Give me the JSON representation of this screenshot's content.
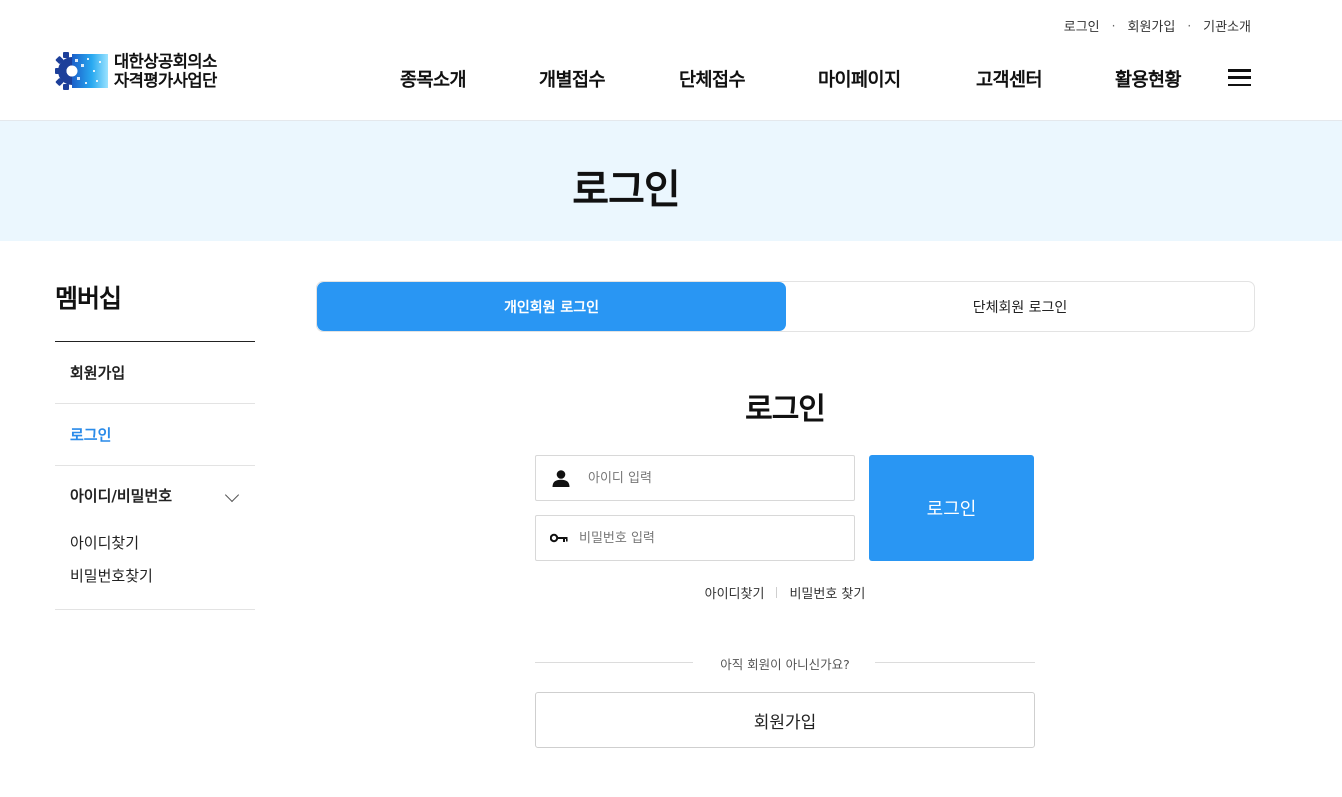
{
  "header": {
    "util_links": [
      "로그인",
      "회원가입",
      "기관소개"
    ],
    "logo": {
      "line1": "대한상공회의소",
      "line2": "자격평가사업단"
    },
    "gnb": [
      "종목소개",
      "개별접수",
      "단체접수",
      "마이페이지",
      "고객센터",
      "활용현황"
    ],
    "menu_icon": "hamburger-icon"
  },
  "page_title": "로그인",
  "sidebar": {
    "title": "멤버십",
    "items": [
      {
        "label": "회원가입",
        "active": false
      },
      {
        "label": "로그인",
        "active": true
      }
    ],
    "group": {
      "label": "아이디/비밀번호",
      "icon": "chevron-down-icon",
      "sub_items": [
        "아이디찾기",
        "비밀번호찾기"
      ]
    }
  },
  "tabs": [
    {
      "label": "개인회원 로그인",
      "active": true
    },
    {
      "label": "단체회원 로그인",
      "active": false
    }
  ],
  "login": {
    "title": "로그인",
    "id_placeholder": "아이디 입력",
    "id_icon": "user-icon",
    "pw_placeholder": "비밀번호 입력",
    "pw_icon": "key-icon",
    "submit_label": "로그인",
    "find_id": "아이디찾기",
    "find_pw": "비밀번호 찾기",
    "not_member": "아직 회원이 아니신가요?",
    "join_label": "회원가입"
  },
  "colors": {
    "accent": "#2996f3",
    "active_text": "#2a8be9",
    "title_band": "#ebf7fe"
  }
}
